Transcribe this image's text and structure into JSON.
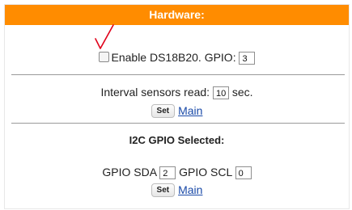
{
  "header": {
    "title": "Hardware:"
  },
  "ds18b20": {
    "checkbox_label": "Enable DS18B20. GPIO:",
    "gpio_value": "3"
  },
  "interval": {
    "label": "Interval sensors read:",
    "value": "10",
    "unit": "sec.",
    "set_label": "Set",
    "main_link": "Main"
  },
  "i2c": {
    "title": "I2C GPIO Selected:",
    "sda_label": "GPIO SDA",
    "sda_value": "2",
    "scl_label": "GPIO SCL",
    "scl_value": "0",
    "set_label": "Set",
    "main_link": "Main"
  },
  "colors": {
    "header_bg": "#ff8c00",
    "link": "#1a4aa8",
    "annotation": "#e0001a"
  }
}
